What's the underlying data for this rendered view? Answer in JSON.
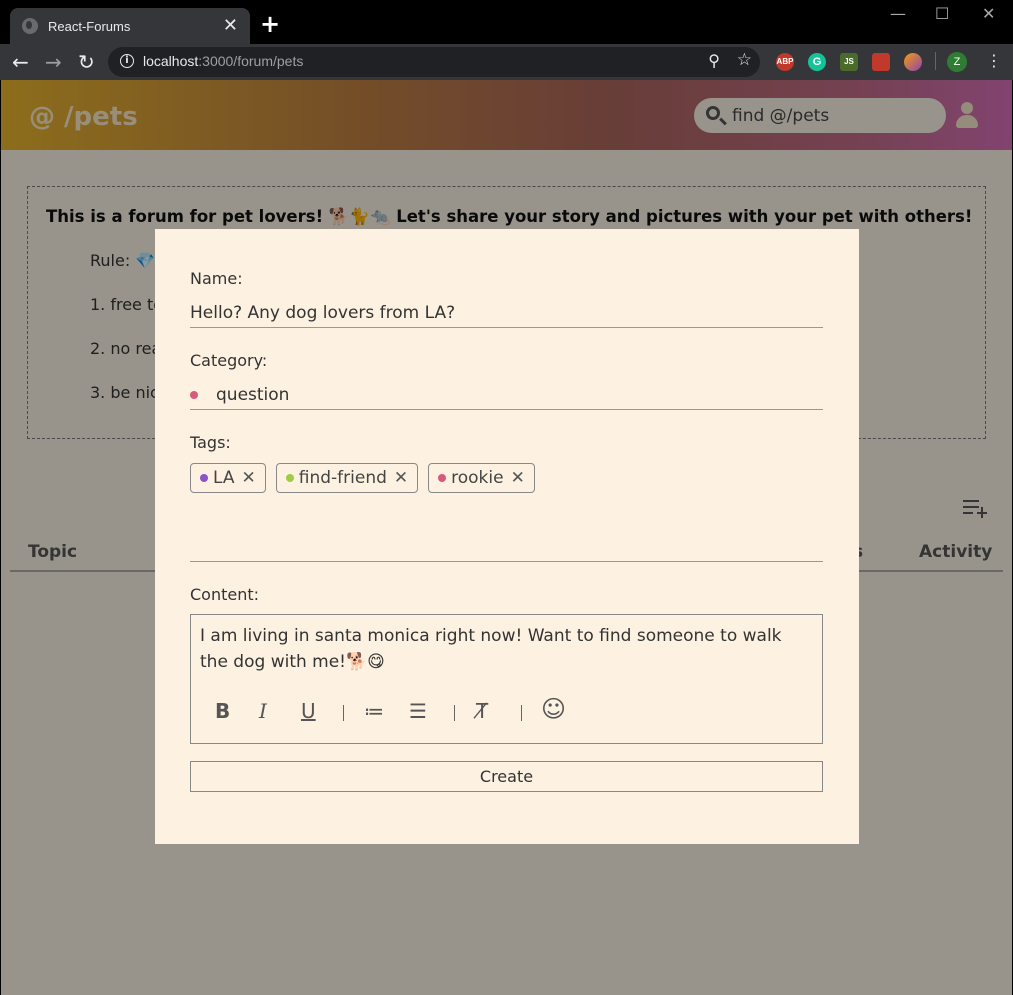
{
  "browser": {
    "tab_title": "React-Forums",
    "tab_close": "✕",
    "new_tab": "+",
    "url_host": "localhost",
    "url_path": ":3000/forum/pets",
    "win_minimize": "—",
    "win_maximize": "☐",
    "win_close": "✕",
    "ext_abp": "ABP",
    "ext_g": "G",
    "ext_js": "JS",
    "profile_initial": "Z"
  },
  "header": {
    "logo": "@ /pets",
    "search_placeholder": "find @/pets"
  },
  "intro": {
    "title": "This is a forum for pet lovers! 🐕🐈🐀 Let's share your story and pictures with your pet with others!",
    "rule_label": "Rule: 💎",
    "rules": [
      "1. free to",
      "2. no rea",
      "3. be nic"
    ]
  },
  "table": {
    "col_topic": "Topic",
    "col_partial": "s",
    "col_activity": "Activity"
  },
  "modal": {
    "name_label": "Name:",
    "name_value": "Hello? Any dog lovers from LA?",
    "category_label": "Category:",
    "category_value": "question",
    "category_color": "#d9587e",
    "tags_label": "Tags:",
    "tags": [
      {
        "label": "LA",
        "color": "#8a55c9"
      },
      {
        "label": "find-friend",
        "color": "#9fcc44"
      },
      {
        "label": "rookie",
        "color": "#d9587e"
      }
    ],
    "content_label": "Content:",
    "content_value": "I am living in santa monica right now! Want to find someone to walk the dog with me!🐕😋",
    "toolbar": {
      "bold": "B",
      "italic": "I",
      "underline": "U",
      "ordered_list": "≔",
      "bullet_list": "☰",
      "clear_format": "T̸",
      "emoji": "☺"
    },
    "create_label": "Create"
  }
}
